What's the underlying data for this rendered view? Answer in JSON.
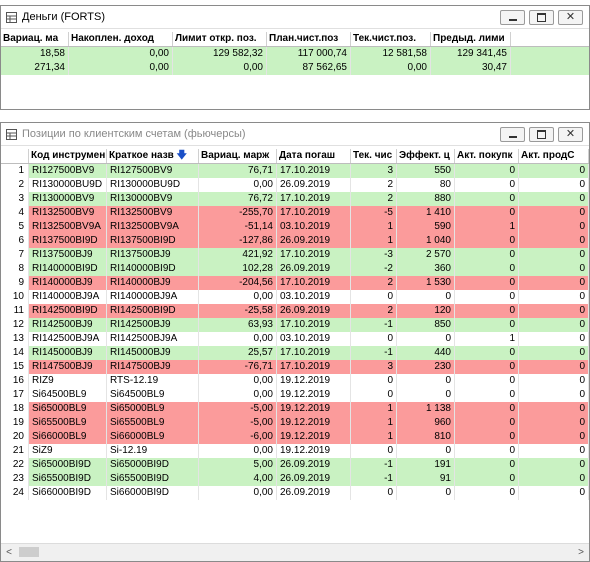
{
  "win1": {
    "title": "Деньги (FORTS)",
    "columns": [
      "Вариац. ма",
      "Накоплен. доход",
      "Лимит откр. поз.",
      "План.чист.поз",
      "Тек.чист.поз.",
      "Предыд. лими"
    ],
    "rows": [
      [
        "18,58",
        "0,00",
        "129 582,32",
        "117 000,74",
        "12 581,58",
        "129 341,45"
      ],
      [
        "271,34",
        "0,00",
        "0,00",
        "87 562,65",
        "0,00",
        "30,47"
      ]
    ]
  },
  "win2": {
    "title": "Позиции по клиентским счетам (фьючерсы)",
    "columns": [
      "Код инструмен",
      "Краткое назв",
      "Вариац. марж",
      "Дата погаш",
      "Тек. чис",
      "Эффект. ц",
      "Акт. покупк",
      "Акт. продС"
    ],
    "sort_indicator": "arrow-down",
    "rows": [
      {
        "n": "1",
        "c": "green",
        "v": [
          "RI127500BV9",
          "RI127500BV9",
          "76,71",
          "17.10.2019",
          "3",
          "550",
          "0",
          "0"
        ]
      },
      {
        "n": "2",
        "c": "white",
        "v": [
          "RI130000BU9D",
          "RI130000BU9D",
          "0,00",
          "26.09.2019",
          "2",
          "80",
          "0",
          "0"
        ]
      },
      {
        "n": "3",
        "c": "green",
        "v": [
          "RI130000BV9",
          "RI130000BV9",
          "76,72",
          "17.10.2019",
          "2",
          "880",
          "0",
          "0"
        ]
      },
      {
        "n": "4",
        "c": "red",
        "v": [
          "RI132500BV9",
          "RI132500BV9",
          "-255,70",
          "17.10.2019",
          "-5",
          "1 410",
          "0",
          "0"
        ]
      },
      {
        "n": "5",
        "c": "red",
        "v": [
          "RI132500BV9A",
          "RI132500BV9A",
          "-51,14",
          "03.10.2019",
          "1",
          "590",
          "1",
          "0"
        ]
      },
      {
        "n": "6",
        "c": "red",
        "v": [
          "RI137500BI9D",
          "RI137500BI9D",
          "-127,86",
          "26.09.2019",
          "1",
          "1 040",
          "0",
          "0"
        ]
      },
      {
        "n": "7",
        "c": "green",
        "v": [
          "RI137500BJ9",
          "RI137500BJ9",
          "421,92",
          "17.10.2019",
          "-3",
          "2 570",
          "0",
          "0"
        ]
      },
      {
        "n": "8",
        "c": "green",
        "v": [
          "RI140000BI9D",
          "RI140000BI9D",
          "102,28",
          "26.09.2019",
          "-2",
          "360",
          "0",
          "0"
        ]
      },
      {
        "n": "9",
        "c": "red",
        "v": [
          "RI140000BJ9",
          "RI140000BJ9",
          "-204,56",
          "17.10.2019",
          "2",
          "1 530",
          "0",
          "0"
        ]
      },
      {
        "n": "10",
        "c": "white",
        "v": [
          "RI140000BJ9A",
          "RI140000BJ9A",
          "0,00",
          "03.10.2019",
          "0",
          "0",
          "0",
          "0"
        ]
      },
      {
        "n": "11",
        "c": "red",
        "v": [
          "RI142500BI9D",
          "RI142500BI9D",
          "-25,58",
          "26.09.2019",
          "2",
          "120",
          "0",
          "0"
        ]
      },
      {
        "n": "12",
        "c": "green",
        "v": [
          "RI142500BJ9",
          "RI142500BJ9",
          "63,93",
          "17.10.2019",
          "-1",
          "850",
          "0",
          "0"
        ]
      },
      {
        "n": "13",
        "c": "white",
        "v": [
          "RI142500BJ9A",
          "RI142500BJ9A",
          "0,00",
          "03.10.2019",
          "0",
          "0",
          "1",
          "0"
        ]
      },
      {
        "n": "14",
        "c": "green",
        "v": [
          "RI145000BJ9",
          "RI145000BJ9",
          "25,57",
          "17.10.2019",
          "-1",
          "440",
          "0",
          "0"
        ]
      },
      {
        "n": "15",
        "c": "red",
        "v": [
          "RI147500BJ9",
          "RI147500BJ9",
          "-76,71",
          "17.10.2019",
          "3",
          "230",
          "0",
          "0"
        ]
      },
      {
        "n": "16",
        "c": "white",
        "v": [
          "RIZ9",
          "RTS-12.19",
          "0,00",
          "19.12.2019",
          "0",
          "0",
          "0",
          "0"
        ]
      },
      {
        "n": "17",
        "c": "white",
        "v": [
          "Si64500BL9",
          "Si64500BL9",
          "0,00",
          "19.12.2019",
          "0",
          "0",
          "0",
          "0"
        ]
      },
      {
        "n": "18",
        "c": "red",
        "v": [
          "Si65000BL9",
          "Si65000BL9",
          "-5,00",
          "19.12.2019",
          "1",
          "1 138",
          "0",
          "0"
        ]
      },
      {
        "n": "19",
        "c": "red",
        "v": [
          "Si65500BL9",
          "Si65500BL9",
          "-5,00",
          "19.12.2019",
          "1",
          "960",
          "0",
          "0"
        ]
      },
      {
        "n": "20",
        "c": "red",
        "v": [
          "Si66000BL9",
          "Si66000BL9",
          "-6,00",
          "19.12.2019",
          "1",
          "810",
          "0",
          "0"
        ]
      },
      {
        "n": "21",
        "c": "white",
        "v": [
          "SiZ9",
          "Si-12.19",
          "0,00",
          "19.12.2019",
          "0",
          "0",
          "0",
          "0"
        ]
      },
      {
        "n": "22",
        "c": "green",
        "v": [
          "Si65000BI9D",
          "Si65000BI9D",
          "5,00",
          "26.09.2019",
          "-1",
          "191",
          "0",
          "0"
        ]
      },
      {
        "n": "23",
        "c": "green",
        "v": [
          "Si65500BI9D",
          "Si65500BI9D",
          "4,00",
          "26.09.2019",
          "-1",
          "91",
          "0",
          "0"
        ]
      },
      {
        "n": "24",
        "c": "white",
        "v": [
          "Si66000BI9D",
          "Si66000BI9D",
          "0,00",
          "26.09.2019",
          "0",
          "0",
          "0",
          "0"
        ]
      }
    ]
  },
  "colors": {
    "positive_row": "#c9f2c2",
    "negative_row": "#fb9b9b"
  }
}
